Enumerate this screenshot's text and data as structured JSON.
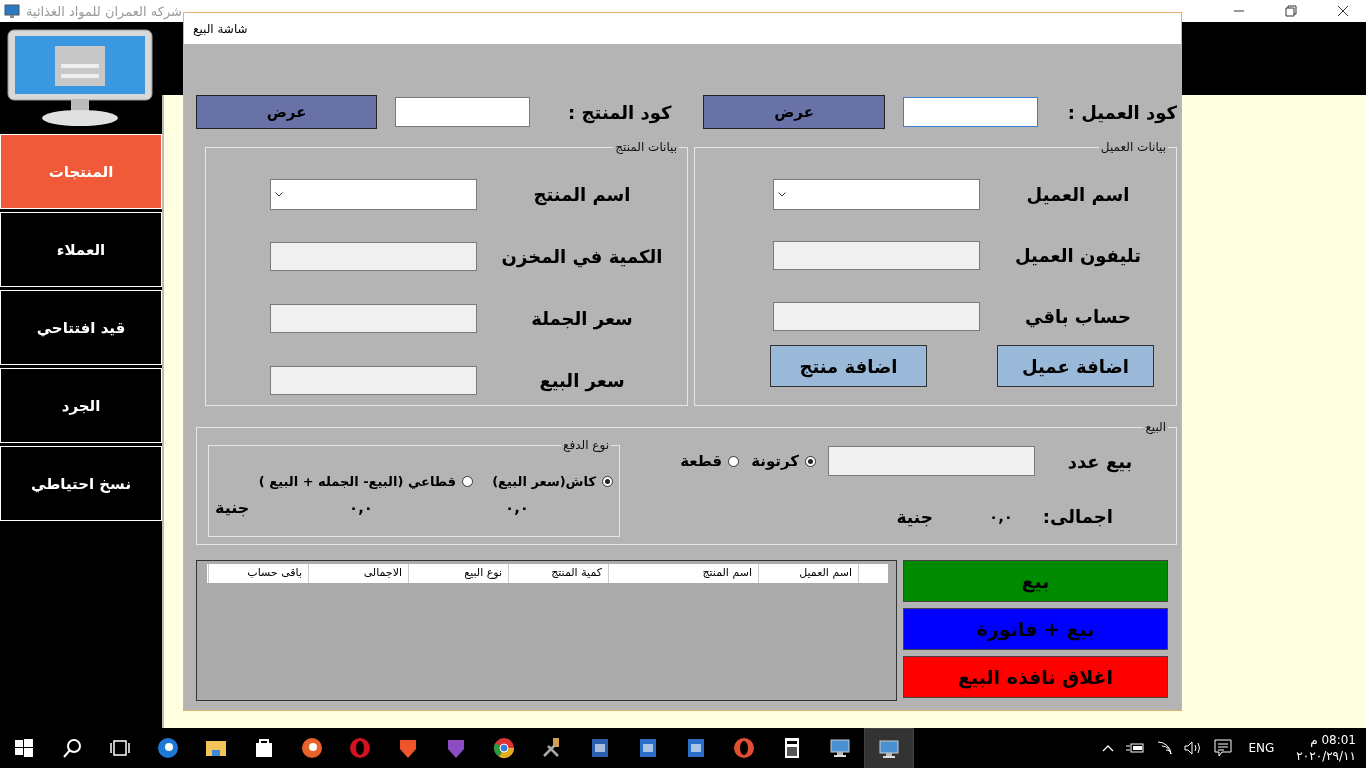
{
  "app_window": {
    "title": "شركه العمران للمواد الغذائية"
  },
  "sidebar": {
    "items": [
      {
        "label": "المنتجات",
        "selected": true
      },
      {
        "label": "العملاء",
        "selected": false
      },
      {
        "label": "قيد افتتاحي",
        "selected": false
      },
      {
        "label": "الجرد",
        "selected": false
      },
      {
        "label": "نسخ احتياطي",
        "selected": false
      }
    ]
  },
  "dialog": {
    "title": "شاشة البيع",
    "customer_code": {
      "label": "كود العميل :",
      "button": "عرض"
    },
    "product_code": {
      "label": "كود المنتج :",
      "button": "عرض"
    },
    "customer_group": {
      "title": "بيانات العميل",
      "fields": [
        {
          "label": "اسم العميل",
          "kind": "combo"
        },
        {
          "label": "تليفون العميل",
          "kind": "readonly"
        },
        {
          "label": "حساب باقي",
          "kind": "readonly"
        }
      ],
      "buttons": [
        "اضافة عميل",
        "اضافة منتج"
      ]
    },
    "product_group": {
      "title": "بيانات المنتج",
      "fields": [
        {
          "label": "اسم المنتج",
          "kind": "combo"
        },
        {
          "label": "الكمية في المخزن",
          "kind": "readonly"
        },
        {
          "label": "سعر الجملة",
          "kind": "readonly"
        },
        {
          "label": "سعر البيع",
          "kind": "readonly"
        }
      ]
    },
    "sale_group": {
      "title": "البيع",
      "quantity_label": "بيع عدد",
      "units": [
        {
          "label": "كرتونة",
          "selected": true
        },
        {
          "label": "قطعة",
          "selected": false
        }
      ],
      "payment": {
        "title": "نوع الدفع",
        "options": [
          {
            "label": "كاش(سعر البيع)",
            "selected": true,
            "amount": "٠,٠"
          },
          {
            "label": "قطاعي (البيع- الجمله + البيع )",
            "selected": false,
            "amount": "٠,٠"
          }
        ],
        "currency": "جنية"
      },
      "total_label": "اجمالى:",
      "total": "٠,٠",
      "total_currency": "جنية"
    },
    "table": {
      "columns": [
        "اسم العميل",
        "اسم المنتج",
        "كمية المنتج",
        "نوع البيع",
        "الاجمالى",
        "باقى حساب"
      ]
    },
    "actions": [
      {
        "label": "بيع",
        "kind": "sell"
      },
      {
        "label": "بيع + فاتورة",
        "kind": "invoice"
      },
      {
        "label": "اغلاق نافذه البيع",
        "kind": "close"
      }
    ]
  },
  "taskbar": {
    "language": "ENG",
    "time": "08:01 م",
    "date": "٢٠٢٠/٢٩/١١"
  }
}
